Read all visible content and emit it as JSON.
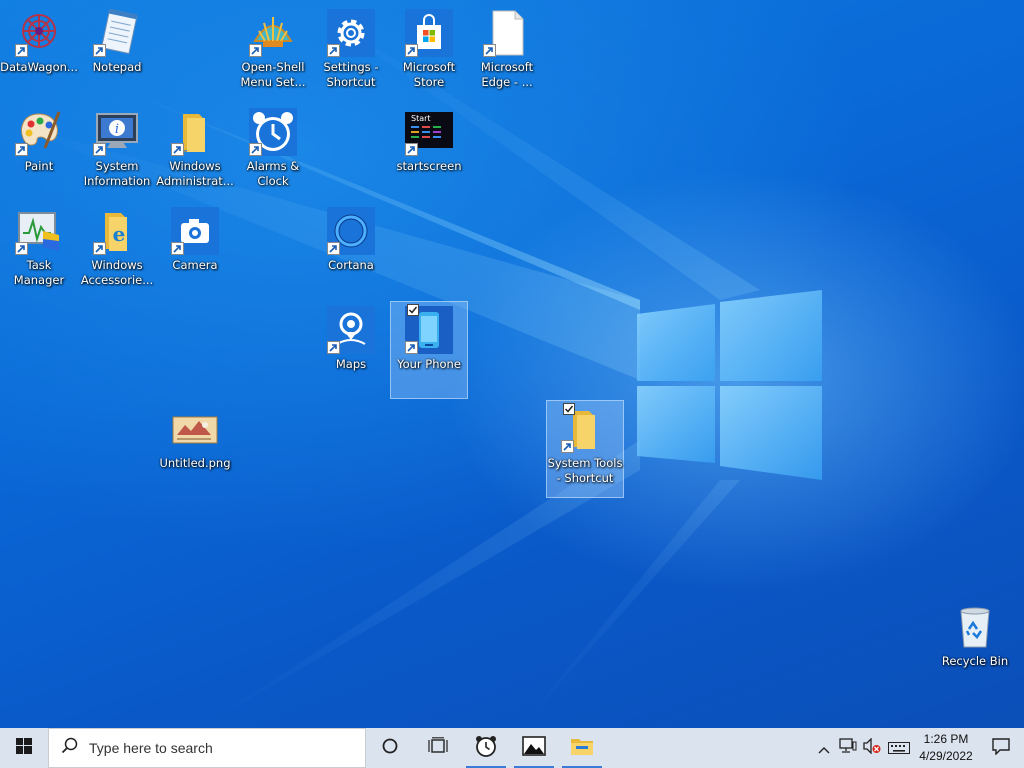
{
  "desktop": {
    "icons": [
      {
        "id": "datawagon",
        "label": "DataWagon...",
        "icon": "datawagon-icon",
        "shortcut": true,
        "selected": false
      },
      {
        "id": "notepad",
        "label": "Notepad",
        "icon": "notepad-icon",
        "shortcut": true,
        "selected": false
      },
      {
        "id": "open-shell",
        "label": "Open-Shell Menu Set...",
        "icon": "shell-icon",
        "shortcut": true,
        "selected": false
      },
      {
        "id": "settings",
        "label": "Settings - Shortcut",
        "icon": "gear-icon",
        "shortcut": true,
        "selected": false
      },
      {
        "id": "store",
        "label": "Microsoft Store",
        "icon": "store-bag-icon",
        "shortcut": true,
        "selected": false
      },
      {
        "id": "edge",
        "label": "Microsoft Edge - ...",
        "icon": "blank-file-icon",
        "shortcut": true,
        "selected": false
      },
      {
        "id": "paint",
        "label": "Paint",
        "icon": "palette-icon",
        "shortcut": true,
        "selected": false
      },
      {
        "id": "sysinfo",
        "label": "System Information",
        "icon": "monitor-info-icon",
        "shortcut": true,
        "selected": false
      },
      {
        "id": "wintools",
        "label": "Windows Administrat...",
        "icon": "folder-icon",
        "shortcut": true,
        "selected": false
      },
      {
        "id": "alarms",
        "label": "Alarms & Clock",
        "icon": "alarm-clock-icon",
        "shortcut": true,
        "selected": false
      },
      {
        "id": "startscreen",
        "label": "startscreen",
        "icon": "startscreen-icon",
        "shortcut": true,
        "selected": false
      },
      {
        "id": "taskmgr",
        "label": "Task Manager",
        "icon": "task-manager-icon",
        "shortcut": true,
        "selected": false
      },
      {
        "id": "accessories",
        "label": "Windows Accessorie...",
        "icon": "accessories-folder-icon",
        "shortcut": true,
        "selected": false
      },
      {
        "id": "camera",
        "label": "Camera",
        "icon": "camera-icon",
        "shortcut": true,
        "selected": false
      },
      {
        "id": "cortana",
        "label": "Cortana",
        "icon": "cortana-ring-icon",
        "shortcut": true,
        "selected": false
      },
      {
        "id": "maps",
        "label": "Maps",
        "icon": "map-pin-icon",
        "shortcut": true,
        "selected": false
      },
      {
        "id": "yourphone",
        "label": "Your Phone",
        "icon": "phone-icon",
        "shortcut": true,
        "selected": true
      },
      {
        "id": "untitled",
        "label": "Untitled.png",
        "icon": "image-thumbnail-icon",
        "shortcut": false,
        "selected": false
      },
      {
        "id": "systools",
        "label": "System Tools - Shortcut",
        "icon": "folder-icon",
        "shortcut": true,
        "selected": true
      },
      {
        "id": "recycle",
        "label": "Recycle Bin",
        "icon": "recycle-bin-icon",
        "shortcut": false,
        "selected": false
      }
    ],
    "startscreen_caption": "Start"
  },
  "taskbar": {
    "search_placeholder": "Type here to search",
    "pinned": [
      "cortana-circle-icon",
      "task-view-icon",
      "alarm-clock-icon",
      "photos-icon",
      "file-explorer-icon"
    ],
    "running": [
      "alarm-clock-icon",
      "photos-icon",
      "file-explorer-icon"
    ],
    "clock_time": "1:26 PM",
    "clock_date": "4/29/2022",
    "tray_icons": [
      "chevron-up-icon",
      "network-icon",
      "volume-muted-icon",
      "keyboard-icon"
    ]
  },
  "colors": {
    "taskbar": "#dbe3ee",
    "accent": "#3a7bd5",
    "wallpaper": "#0a68d6"
  }
}
